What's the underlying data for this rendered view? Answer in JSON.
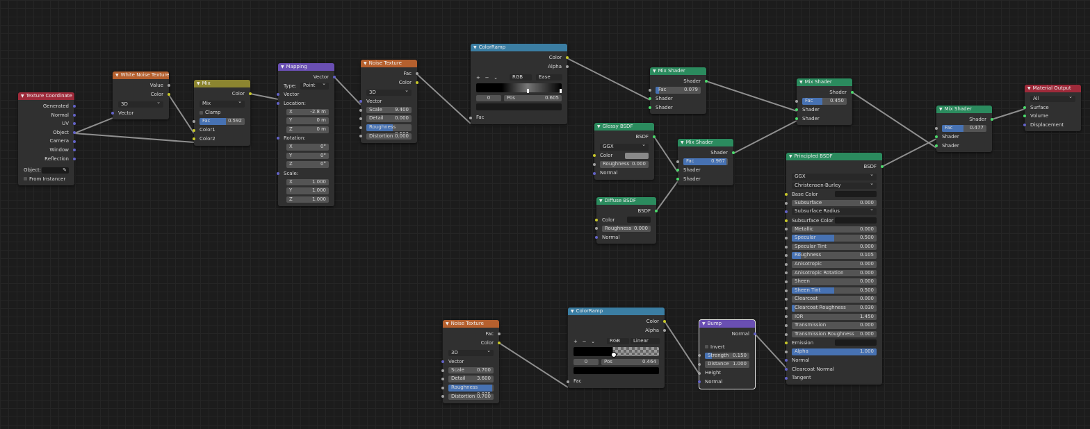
{
  "nodes": {
    "texcoord": {
      "title": "Texture Coordinate",
      "outputs": [
        "Generated",
        "Normal",
        "UV",
        "Object",
        "Camera",
        "Window",
        "Reflection"
      ],
      "object_label": "Object:",
      "from_instancer": "From Instancer"
    },
    "whitenoise": {
      "title": "White Noise Texture",
      "out_value": "Value",
      "out_color": "Color",
      "dim": "3D",
      "in_vector": "Vector"
    },
    "mix": {
      "title": "Mix",
      "out_color": "Color",
      "mode": "Mix",
      "clamp": "Clamp",
      "fac_label": "Fac",
      "fac_value": "0.592",
      "fac_fraction": 0.592,
      "color1": "Color1",
      "color2": "Color2"
    },
    "mapping": {
      "title": "Mapping",
      "out_vector": "Vector",
      "type_label": "Type:",
      "type_value": "Point",
      "in_vector": "Vector",
      "location": "Location:",
      "loc": [
        [
          "X",
          "-2.8 m"
        ],
        [
          "Y",
          "0 m"
        ],
        [
          "Z",
          "0 m"
        ]
      ],
      "rotation": "Rotation:",
      "rot": [
        [
          "X",
          "0°"
        ],
        [
          "Y",
          "0°"
        ],
        [
          "Z",
          "0°"
        ]
      ],
      "scale": "Scale:",
      "scl": [
        [
          "X",
          "1.000"
        ],
        [
          "Y",
          "1.000"
        ],
        [
          "Z",
          "1.000"
        ]
      ]
    },
    "noise1": {
      "title": "Noise Texture",
      "out_fac": "Fac",
      "out_color": "Color",
      "dim": "3D",
      "in_vector": "Vector",
      "scale": [
        "Scale",
        "9.400"
      ],
      "detail": [
        "Detail",
        "0.000"
      ],
      "roughness": [
        "Roughness",
        "0.592"
      ],
      "roughness_fraction": 0.592,
      "distortion": [
        "Distortion",
        "0.000"
      ]
    },
    "ramp1": {
      "title": "ColorRamp",
      "out_color": "Color",
      "out_alpha": "Alpha",
      "tools": [
        "+",
        "−",
        "⌄"
      ],
      "mode": "RGB",
      "interp": "Ease",
      "index": "0",
      "pos_label": "Pos",
      "pos_value": "0.605",
      "in_fac": "Fac"
    },
    "mixsh1": {
      "title": "Mix Shader",
      "out": "Shader",
      "fac_label": "Fac",
      "fac_value": "0.079",
      "fac_fraction": 0.079,
      "in1": "Shader",
      "in2": "Shader"
    },
    "glossy": {
      "title": "Glossy BSDF",
      "out": "BSDF",
      "dist": "GGX",
      "color": "Color",
      "rough": [
        "Roughness",
        "0.000"
      ],
      "normal": "Normal"
    },
    "diffuse": {
      "title": "Diffuse BSDF",
      "out": "BSDF",
      "color": "Color",
      "rough": [
        "Roughness",
        "0.000"
      ],
      "normal": "Normal"
    },
    "mixsh2": {
      "title": "Mix Shader",
      "out": "Shader",
      "fac_label": "Fac",
      "fac_value": "0.967",
      "fac_fraction": 0.967,
      "in1": "Shader",
      "in2": "Shader"
    },
    "mixsh3": {
      "title": "Mix Shader",
      "out": "Shader",
      "fac_label": "Fac",
      "fac_value": "0.450",
      "fac_fraction": 0.45,
      "in1": "Shader",
      "in2": "Shader"
    },
    "mixsh4": {
      "title": "Mix Shader",
      "out": "Shader",
      "fac_label": "Fac",
      "fac_value": "0.477",
      "fac_fraction": 0.477,
      "in1": "Shader",
      "in2": "Shader"
    },
    "output": {
      "title": "Material Output",
      "target": "All",
      "surface": "Surface",
      "volume": "Volume",
      "displacement": "Displacement"
    },
    "principled": {
      "title": "Principled BSDF",
      "out": "BSDF",
      "dist": "GGX",
      "sss": "Christensen-Burley",
      "rows": [
        {
          "t": "swatch",
          "label": "Base Color",
          "sock": "yel"
        },
        {
          "t": "val",
          "label": "Subsurface",
          "value": "0.000",
          "fill": 0,
          "sock": "gray"
        },
        {
          "t": "dd",
          "label": "Subsurface Radius",
          "sock": "pur"
        },
        {
          "t": "swatch",
          "label": "Subsurface Color",
          "sock": "yel"
        },
        {
          "t": "val",
          "label": "Metallic",
          "value": "0.000",
          "fill": 0,
          "sock": "gray"
        },
        {
          "t": "val",
          "label": "Specular",
          "value": "0.500",
          "fill": 0.5,
          "sock": "gray"
        },
        {
          "t": "val",
          "label": "Specular Tint",
          "value": "0.000",
          "fill": 0,
          "sock": "gray"
        },
        {
          "t": "val",
          "label": "Roughness",
          "value": "0.105",
          "fill": 0.105,
          "sock": "gray"
        },
        {
          "t": "val",
          "label": "Anisotropic",
          "value": "0.000",
          "fill": 0,
          "sock": "gray"
        },
        {
          "t": "val",
          "label": "Anisotropic Rotation",
          "value": "0.000",
          "fill": 0,
          "sock": "gray"
        },
        {
          "t": "val",
          "label": "Sheen",
          "value": "0.000",
          "fill": 0,
          "sock": "gray"
        },
        {
          "t": "val",
          "label": "Sheen Tint",
          "value": "0.500",
          "fill": 0.5,
          "sock": "gray"
        },
        {
          "t": "val",
          "label": "Clearcoat",
          "value": "0.000",
          "fill": 0,
          "sock": "gray"
        },
        {
          "t": "val",
          "label": "Clearcoat Roughness",
          "value": "0.030",
          "fill": 0.03,
          "sock": "gray"
        },
        {
          "t": "val",
          "label": "IOR",
          "value": "1.450",
          "fill": 0,
          "sock": "gray"
        },
        {
          "t": "val",
          "label": "Transmission",
          "value": "0.000",
          "fill": 0,
          "sock": "gray"
        },
        {
          "t": "val",
          "label": "Transmission Roughness",
          "value": "0.000",
          "fill": 0,
          "sock": "gray"
        },
        {
          "t": "swatch",
          "label": "Emission",
          "sock": "yel"
        },
        {
          "t": "val",
          "label": "Alpha",
          "value": "1.000",
          "fill": 1,
          "sock": "gray"
        },
        {
          "t": "plain",
          "label": "Normal",
          "sock": "pur"
        },
        {
          "t": "plain",
          "label": "Clearcoat Normal",
          "sock": "pur"
        },
        {
          "t": "plain",
          "label": "Tangent",
          "sock": "pur"
        }
      ]
    },
    "noise2": {
      "title": "Noise Texture",
      "out_fac": "Fac",
      "out_color": "Color",
      "dim": "3D",
      "in_vector": "Vector",
      "scale": [
        "Scale",
        "0.700"
      ],
      "detail": [
        "Detail",
        "3.600"
      ],
      "roughness": [
        "Roughness",
        "0.975"
      ],
      "roughness_fraction": 0.975,
      "distortion": [
        "Distortion",
        "0.700"
      ]
    },
    "ramp2": {
      "title": "ColorRamp",
      "out_color": "Color",
      "out_alpha": "Alpha",
      "tools": [
        "+",
        "−",
        "⌄"
      ],
      "mode": "RGB",
      "interp": "Linear",
      "index": "0",
      "pos_label": "Pos",
      "pos_value": "0.464",
      "in_fac": "Fac"
    },
    "bump": {
      "title": "Bump",
      "out": "Normal",
      "invert": "Invert",
      "strength": [
        "Strength",
        "0.150"
      ],
      "strength_fraction": 0.15,
      "distance": [
        "Distance",
        "1.000"
      ],
      "height": "Height",
      "normal": "Normal"
    }
  },
  "colors": {
    "input_header": "#9e2a3a",
    "texture_header": "#b5602e",
    "converter_header": "#3b7ea3",
    "vector_header": "#6a4fb3",
    "shader_header": "#2b8b5e",
    "color_header": "#8c8530",
    "slider_fill": "#4772b3",
    "wire": "#9a9a9a"
  }
}
